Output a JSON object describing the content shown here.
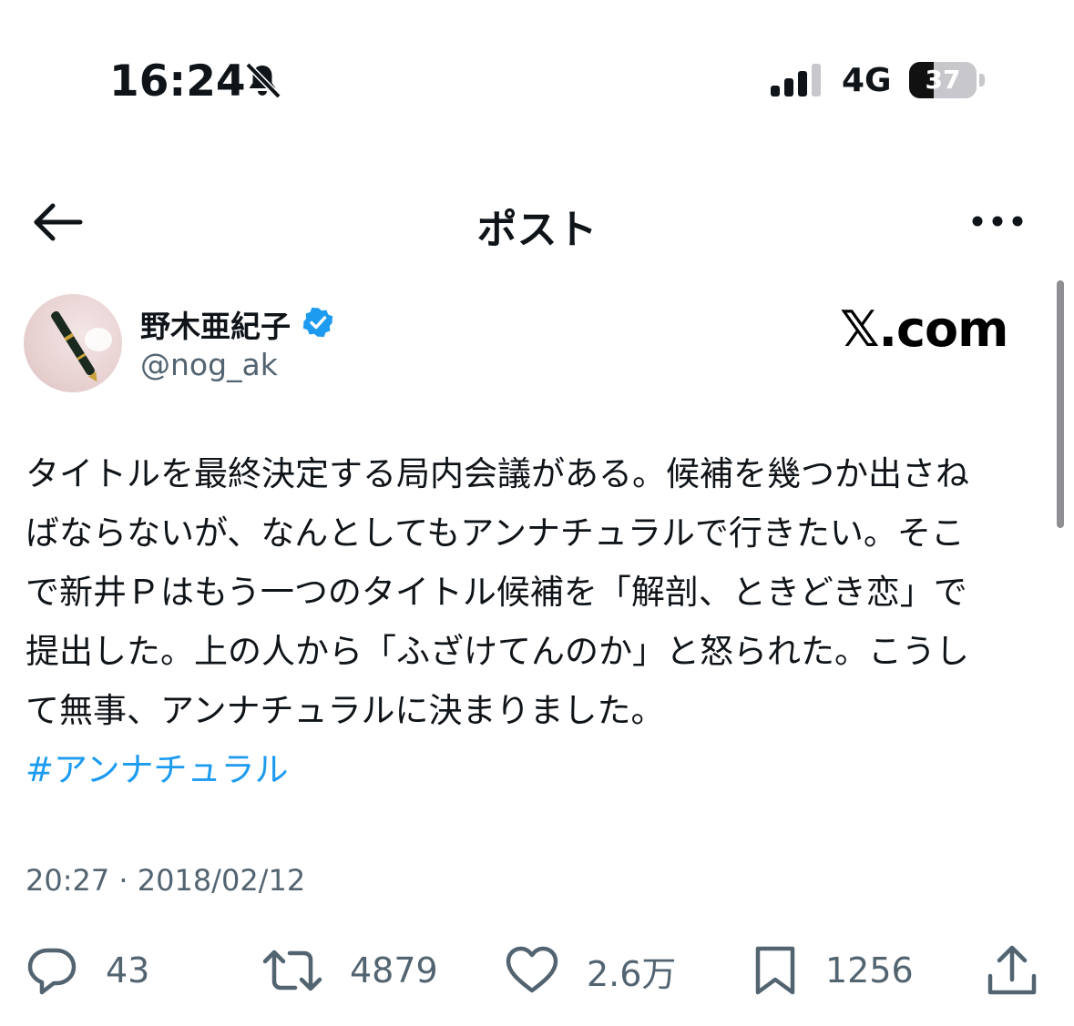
{
  "status_bar": {
    "time": "16:24",
    "network": "4G",
    "battery": "37",
    "battery_level": 0.37,
    "icons": [
      "bell-slash-icon",
      "signal-icon",
      "battery-icon"
    ]
  },
  "header": {
    "title": "ポスト",
    "icons": [
      "back-arrow-icon",
      "more-icon"
    ]
  },
  "author": {
    "name": "野木亜紀子",
    "handle": "@nog_ak",
    "icons": [
      "avatar",
      "verified-badge-icon"
    ]
  },
  "watermark": "𝕏.com",
  "post": {
    "text": "タイトルを最終決定する局内会議がある。候補を幾つか出さね\nばならないが、なんとしてもアンナチュラルで行きたい。そこ\nで新井Ｐはもう一つのタイトル候補を「解剖、ときどき恋」で\n提出した。上の人から「ふざけてんのか」と怒られた。こうし\nて無事、アンナチュラルに決まりました。",
    "hashtag": "#アンナチュラル",
    "timestamp": "20:27 · 2018/02/12"
  },
  "actions": {
    "replies": "43",
    "reposts": "4879",
    "likes": "2.6万",
    "bookmarks": "1256",
    "icons": [
      "reply-icon",
      "repost-icon",
      "like-icon",
      "bookmark-icon",
      "share-icon"
    ]
  },
  "colors": {
    "text": "#0f1419",
    "secondary": "#536471",
    "link": "#1d9bf0",
    "verified": "#1d9bf0"
  }
}
